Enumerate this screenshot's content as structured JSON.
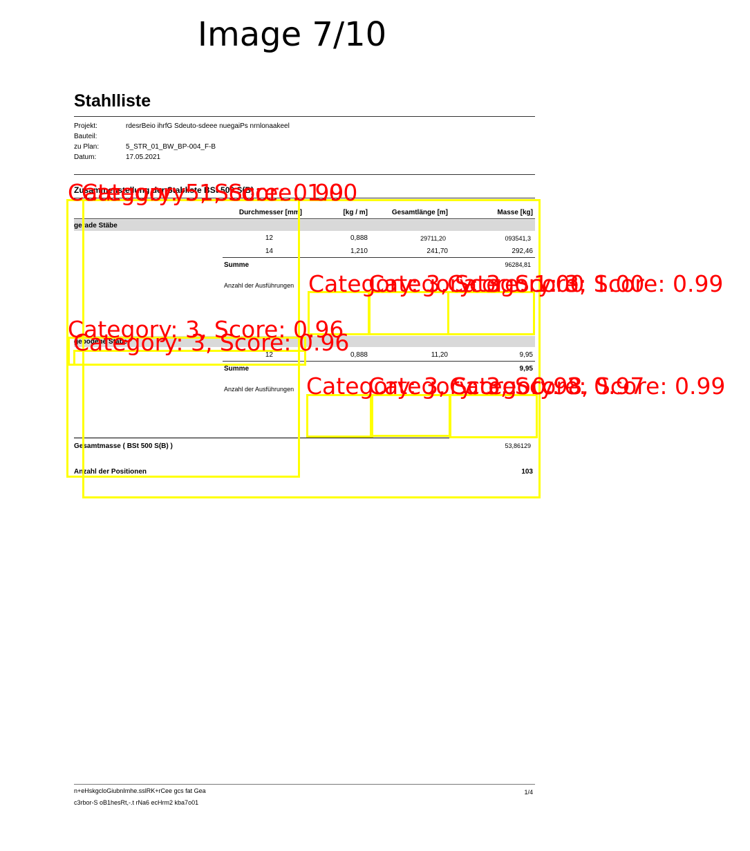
{
  "figure_title": "Image 7/10",
  "document": {
    "title": "Stahlliste",
    "meta": [
      {
        "key": "Projekt:",
        "value": "rdesrBeio  ihrfG  Sdeuto-sdeee nuegaiPs nrnlonaakeel"
      },
      {
        "key": "Bauteil:",
        "value": ""
      },
      {
        "key": "zu Plan:",
        "value": "5_STR_01_BW_BP-004_F-B"
      },
      {
        "key": "Datum:",
        "value": "17.05.2021"
      }
    ],
    "section_title": "Zusammenstellung der Stabliste BSt 500 S(B) :",
    "headers": [
      "Durchmesser [mm]",
      "[kg / m]",
      "Gesamtlänge [m]",
      "Masse [kg]"
    ],
    "group1": {
      "label": "gerade Stäbe",
      "rows": [
        {
          "d": "12",
          "kgm": "0,888",
          "len": "29711,20",
          "mass": "093541,3"
        },
        {
          "d": "14",
          "kgm": "1,210",
          "len": "241,70",
          "mass": "292,46"
        }
      ],
      "sum_label": "Summe",
      "sum_value": "96284,81",
      "count_label": "Anzahl der Ausführungen"
    },
    "group2": {
      "label": "gebogene Stäbe",
      "rows": [
        {
          "d": "12",
          "kgm": "0,888",
          "len": "11,20",
          "mass": "9,95"
        }
      ],
      "sum_label": "Summe",
      "sum_value": "9,95",
      "count_label": "Anzahl der Ausführungen"
    },
    "total_label": "Gesamtmasse ( BSt 500 S(B) )",
    "total_value": "53,86129",
    "positions_label": "Anzahl der Positionen",
    "positions_value": "103",
    "footer_line1": "n+eHskgcloGiubnImhe.sslRK+rCee gcs  fat Gea",
    "footer_line2": "c3rbor-S oB1hesRt,-.t    rNa6 ecHrm2  kba7o01",
    "page": "1/4"
  },
  "detections": {
    "color_box": "#ffff00",
    "color_label": "#ff0000",
    "labels": [
      "Category: 5, Score: 0.99",
      "Category: 1, Score: 1.00",
      "Category: 3, Score: 1.00",
      "Category: 3, Score: 1.00",
      "Category: 3, Score: 0.99",
      "Category: 3, Score: 0.96",
      "Category: 3, Score: 0.96",
      "Category: 3, Score: 0.98",
      "Category: 3, Score: 0.97",
      "Category: 3, Score: 0.99"
    ]
  }
}
